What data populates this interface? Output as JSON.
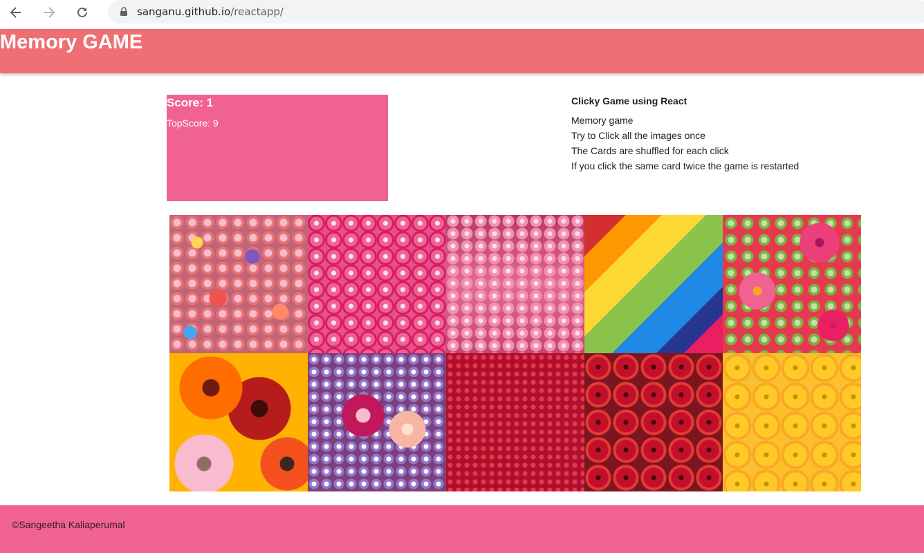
{
  "browser": {
    "url_host": "sanganu.github.io",
    "url_path": "/reactapp/",
    "icons": [
      "back-arrow-icon",
      "forward-arrow-icon",
      "reload-icon",
      "lock-icon"
    ]
  },
  "header": {
    "title": "Memory GAME",
    "background_color": "#ef6f74"
  },
  "scoreboard": {
    "score_label": "Score: 1",
    "top_score_label": "TopScore: 9",
    "background_color": "#f06292"
  },
  "info": {
    "title": "Clicky Game using React",
    "lines": [
      "Memory game",
      "Try to Click all the images once",
      "The Cards are shuffled for each click",
      "If you click the same card twice the game is restarted"
    ]
  },
  "cards": [
    {
      "subject": "mixed colorful flowers"
    },
    {
      "subject": "pink roses"
    },
    {
      "subject": "pink azaleas"
    },
    {
      "subject": "rainbow flowers"
    },
    {
      "subject": "pink gerberas"
    },
    {
      "subject": "orange and pink gerberas"
    },
    {
      "subject": "mixed flower bouquet"
    },
    {
      "subject": "red flower field"
    },
    {
      "subject": "red roses"
    },
    {
      "subject": "yellow roses"
    }
  ],
  "footer": {
    "text": "©Sangeetha Kaliaperumal",
    "background_color": "#f06292"
  }
}
